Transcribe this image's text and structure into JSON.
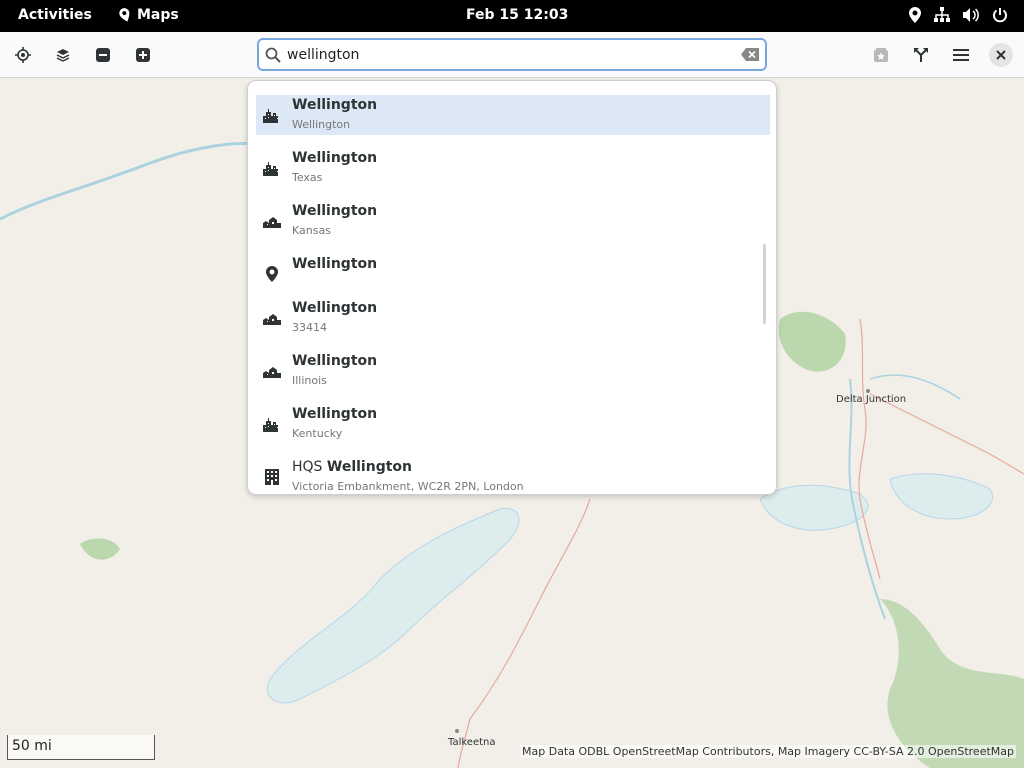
{
  "topbar": {
    "activities": "Activities",
    "app_name": "Maps",
    "clock": "Feb 15  12:03",
    "tray_icons": [
      "location-icon",
      "network-icon",
      "volume-icon",
      "power-icon"
    ]
  },
  "headerbar": {
    "left_buttons": [
      "locate-icon",
      "layers-icon",
      "zoom-out-icon",
      "zoom-in-icon"
    ],
    "right_buttons": [
      "favorites-icon",
      "route-icon",
      "menu-icon",
      "close-icon"
    ]
  },
  "search": {
    "value": "wellington",
    "placeholder": ""
  },
  "results": [
    {
      "pre": "",
      "title": "Wellington",
      "subtitle": "Wellington",
      "icon": "city-icon",
      "selected": true
    },
    {
      "pre": "",
      "title": "Wellington",
      "subtitle": "Texas",
      "icon": "city-icon",
      "selected": false
    },
    {
      "pre": "",
      "title": "Wellington",
      "subtitle": "Kansas",
      "icon": "town-icon",
      "selected": false
    },
    {
      "pre": "",
      "title": "Wellington",
      "subtitle": "",
      "icon": "pin-icon",
      "selected": false
    },
    {
      "pre": "",
      "title": "Wellington",
      "subtitle": "33414",
      "icon": "town-icon",
      "selected": false
    },
    {
      "pre": "",
      "title": "Wellington",
      "subtitle": "Illinois",
      "icon": "town-icon",
      "selected": false
    },
    {
      "pre": "",
      "title": "Wellington",
      "subtitle": "Kentucky",
      "icon": "city-icon",
      "selected": false
    },
    {
      "pre": "HQS ",
      "title": "Wellington",
      "subtitle": "Victoria Embankment, WC2R 2PN, London",
      "icon": "building-icon",
      "selected": false
    }
  ],
  "map": {
    "labels": {
      "delta_junction": "Delta Junction",
      "talkeetna": "Talkeetna"
    },
    "scale": "50 mi",
    "attribution": "Map Data ODBL OpenStreetMap Contributors, Map Imagery CC-BY-SA 2.0 OpenStreetMap",
    "colors": {
      "land": "#f2efe9",
      "water": "#aad3df",
      "ice": "#ddecec",
      "forest": "#add19e",
      "road": "#e8a89a"
    }
  }
}
